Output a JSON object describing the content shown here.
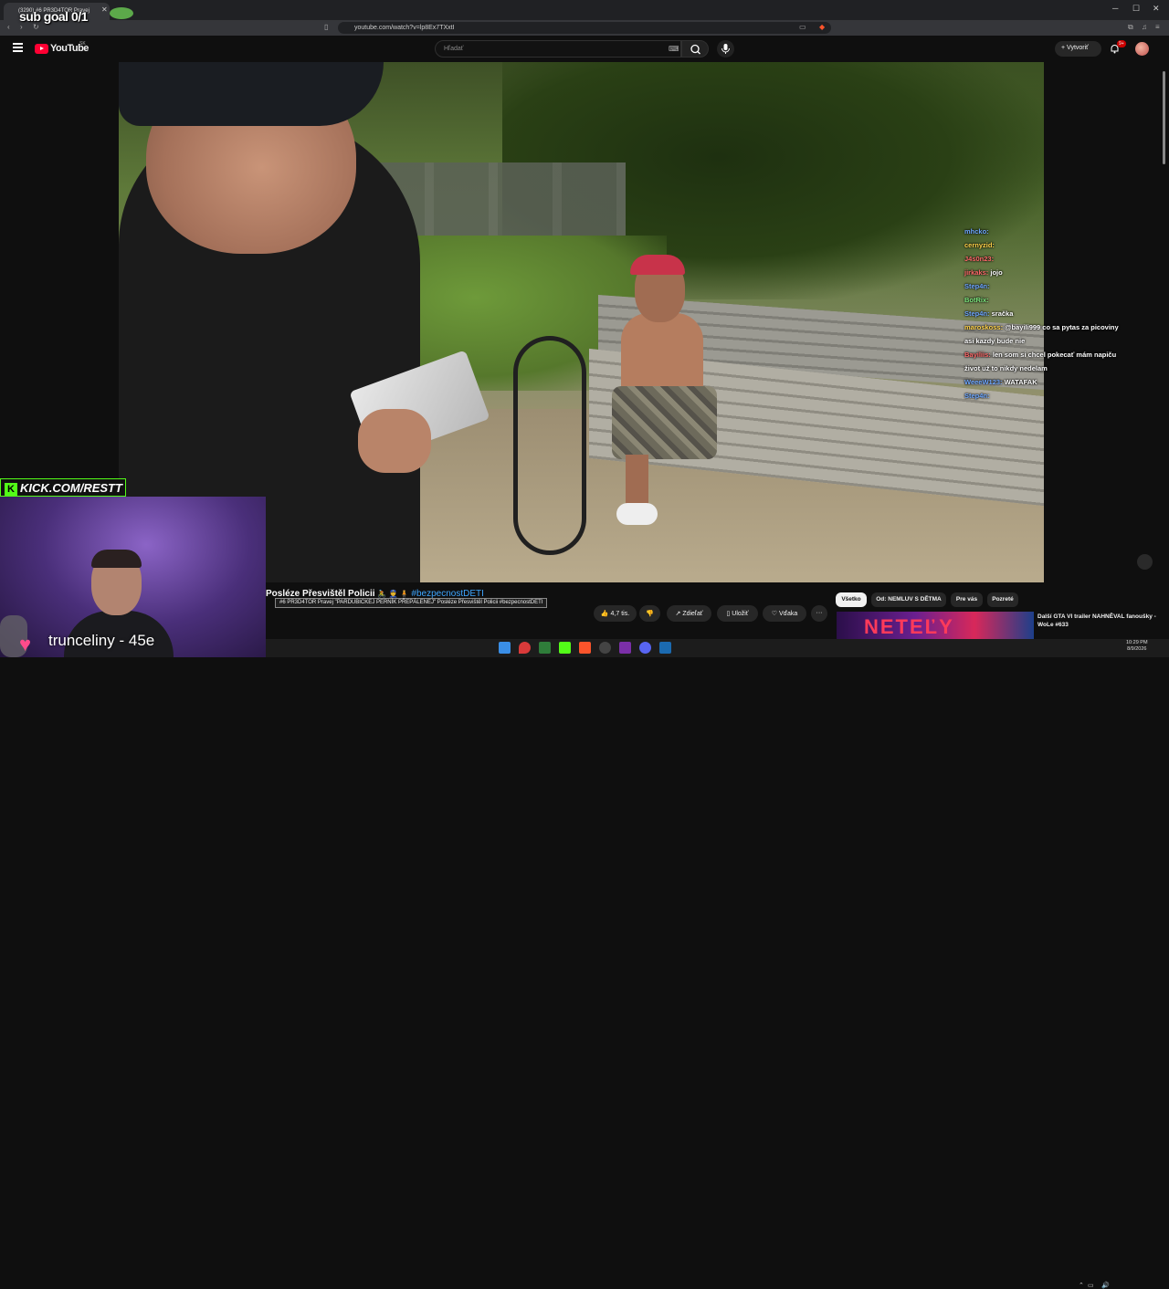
{
  "browser": {
    "tab_title": "(3290) #6 PR3D4TOR Pravej",
    "url": "youtube.com/watch?v=lp8Ex7TXxtI",
    "controls": [
      "‹",
      "›",
      "↻"
    ],
    "win_controls": [
      "─",
      "☐",
      "✕"
    ]
  },
  "youtube": {
    "brand": "YouTube",
    "region": "SK",
    "search_placeholder": "Hľadať",
    "create_label": "Vytvoriť",
    "notif_count": "9+"
  },
  "overlay": {
    "sub_goal": "sub goal 0/1",
    "kick_label": "KICK.COM/RESTT",
    "viewer_text": "trunceliny - 45e"
  },
  "chat": [
    {
      "user": "mhcko:",
      "msg": "",
      "cls": "u"
    },
    {
      "user": "cernyzid:",
      "msg": "",
      "cls": "y"
    },
    {
      "user": "J4s0n23:",
      "msg": "",
      "cls": "r"
    },
    {
      "user": "jirkaks:",
      "msg": "jojo",
      "cls": "r"
    },
    {
      "user": "Step4n:",
      "msg": "",
      "cls": "u"
    },
    {
      "user": "BotRix:",
      "msg": "",
      "cls": "g"
    },
    {
      "user": "Step4n:",
      "msg": "sračka",
      "cls": "u"
    },
    {
      "user": "maroskoss:",
      "msg": "@bayili999 co sa pytas za picoviny asi kazdy bude nie",
      "cls": "y"
    },
    {
      "user": "Bayiliis:",
      "msg": "len som si chcel pokecať mám napiču život už to nikdy nedelam",
      "cls": "r"
    },
    {
      "user": "WeeeW123:",
      "msg": "WATAFAK",
      "cls": "u"
    },
    {
      "user": "Step4n:",
      "msg": "",
      "cls": "u"
    }
  ],
  "video": {
    "title_prefix": "Posléze Přesvištěl Policii",
    "title_hashtag": "#bezpecnostDETI",
    "tooltip": "#6 PR3D4TOR Pravej \"PARDUBICKEJ PERNÍK PŘEPÁLENEJ\" Posléze Přesvištěl Policii #bezpecnostDETI",
    "likes": "4,7 tis.",
    "share": "Zdieľať",
    "save": "Uložiť",
    "thanks": "Vďaka",
    "more": "···"
  },
  "chips": [
    "Všetko",
    "Od: NEMLUV S DĚTMA",
    "Pre vás",
    "Pozreté"
  ],
  "recommendation": {
    "title": "Další GTA VI trailer NAHNĚVAL fanoušky - WoLe #633",
    "thumb_text": "NETEĽY"
  },
  "taskbar": {
    "time": "10:29 PM",
    "date": "8/9/2026"
  },
  "colors": {
    "youtube_red": "#ff0033",
    "kick_green": "#53fc18",
    "link_blue": "#3ea6ff"
  }
}
